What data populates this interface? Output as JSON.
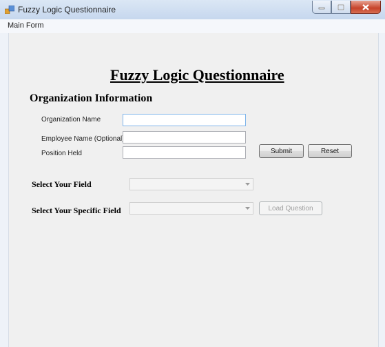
{
  "window": {
    "title": "Fuzzy Logic Questionnaire"
  },
  "menu": {
    "items": [
      "Main Form"
    ]
  },
  "form": {
    "heading": "Fuzzy Logic Questionnaire",
    "section_title": "Organization Information",
    "fields": [
      {
        "label": "Organization Name",
        "value": ""
      },
      {
        "label": "Employee Name (Optional)",
        "value": ""
      },
      {
        "label": "Position Held",
        "value": ""
      }
    ],
    "submit_label": "Submit",
    "reset_label": "Reset",
    "select_field_label": "Select Your Field",
    "select_specific_label": "Select Your Specific Field",
    "load_question_label": "Load Question"
  }
}
